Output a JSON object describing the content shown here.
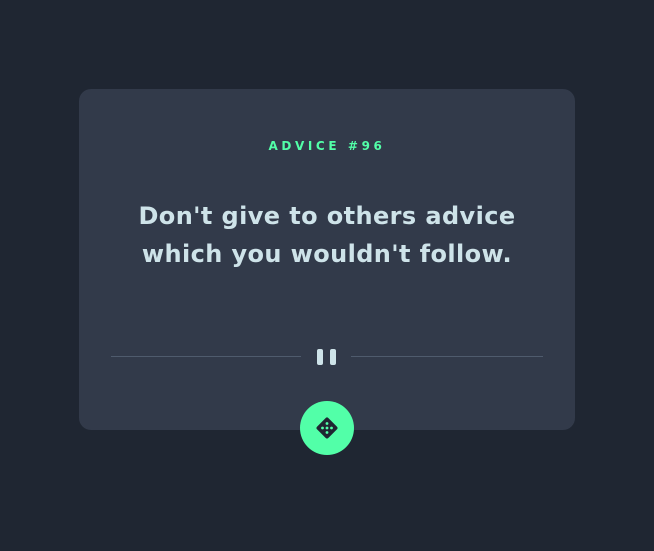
{
  "advice": {
    "id_label": "ADVICE #96",
    "quote": "Don't give to others advice which you wouldn't follow."
  },
  "icons": {
    "divider": "pause-icon",
    "generate": "dice-icon"
  },
  "colors": {
    "background": "#1f2632",
    "card": "#323a4a",
    "accent": "#52ffa8",
    "text": "#cee3e9",
    "divider_line": "#4f5b6d"
  }
}
